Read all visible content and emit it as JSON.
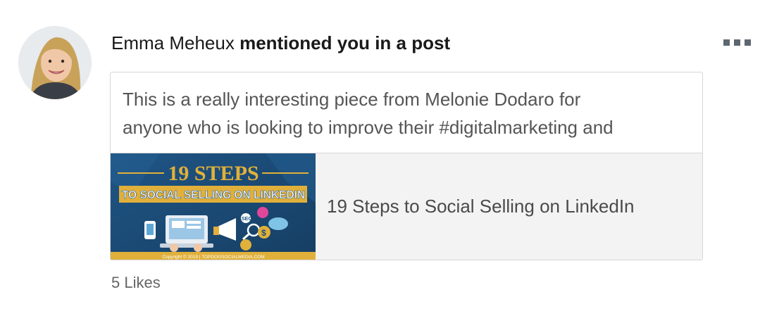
{
  "notification": {
    "actor_name": "Emma Meheux",
    "action_text": "mentioned you in a post",
    "more_icon": "more-horizontal-icon"
  },
  "post": {
    "excerpt_lines": [
      "This is a really interesting piece from Melonie Dodaro for",
      "anyone who is looking to improve their #digitalmarketing and"
    ],
    "link": {
      "title": "19 Steps to Social Selling on LinkedIn",
      "thumbnail": {
        "headline": "19 STEPS",
        "subheadline": "TO SOCIAL SELLING ON LINKEDIN",
        "footer": "Copyright © 2019 | TOPDOGSOCIALMEDIA.COM",
        "badge": "SEO"
      }
    }
  },
  "likes_text": "5 Likes",
  "colors": {
    "thumb_bg": "#1d4f7c",
    "thumb_gold": "#e0b03a",
    "text_gray": "#555555"
  }
}
